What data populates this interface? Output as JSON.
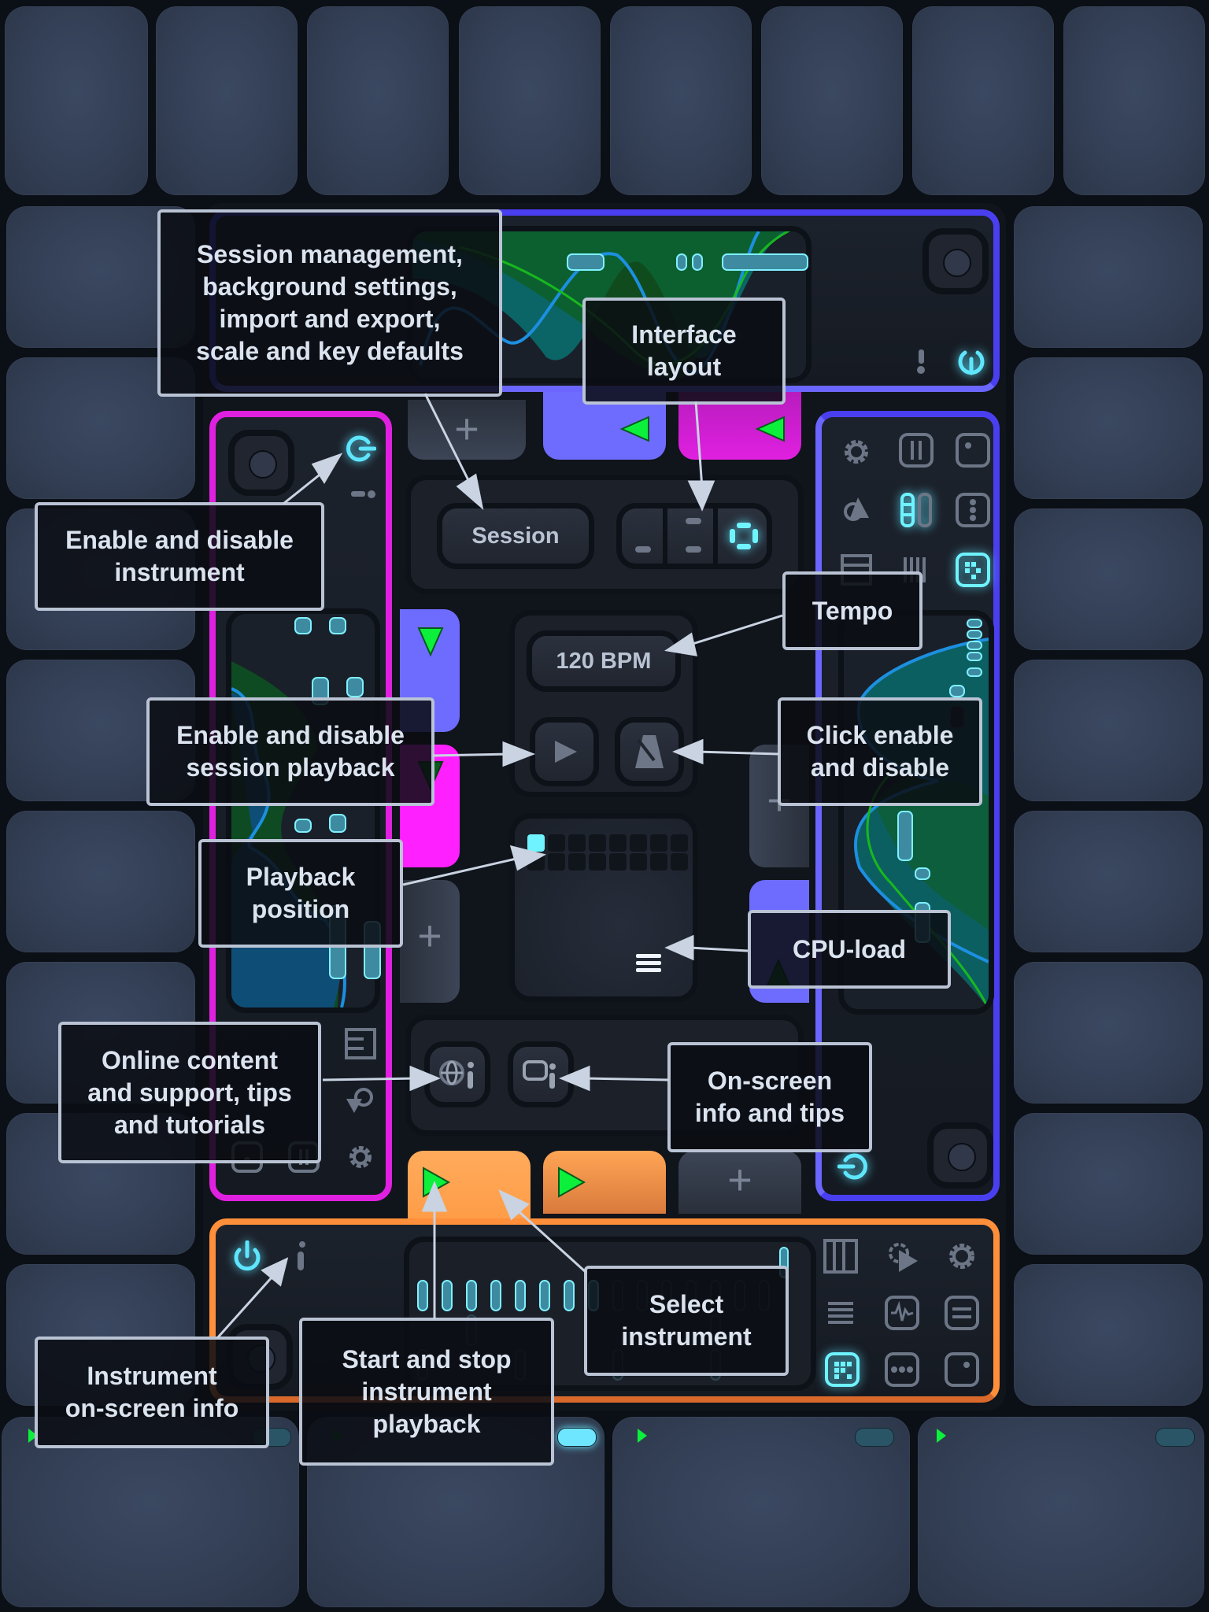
{
  "callouts": {
    "session_management": "Session management,\nbackground settings,\nimport and export,\nscale and key defaults",
    "interface_layout": "Interface\nlayout",
    "enable_instrument": "Enable and disable\ninstrument",
    "tempo": "Tempo",
    "session_playback": "Enable and disable\nsession playback",
    "click": "Click enable\nand disable",
    "playback_position": "Playback\nposition",
    "cpu_load": "CPU-load",
    "online_content": "Online content\nand support, tips\nand tutorials",
    "onscreen_info": "On-screen\ninfo and tips",
    "select_instrument": "Select\ninstrument",
    "instrument_info": "Instrument\non-screen info",
    "start_stop": "Start and stop\ninstrument\nplayback"
  },
  "session": {
    "session_button": "Session",
    "tempo": "120 BPM",
    "playback_position_step": 1,
    "steps_per_row": 8,
    "layout_options": [
      "bottom",
      "split",
      "full"
    ],
    "layout_selected": "full"
  },
  "instrument_tabs": {
    "top": [
      {
        "color": "#6e6cff",
        "state": "play"
      },
      {
        "color": "#e020e0",
        "state": "play"
      },
      {
        "type": "add",
        "label": "+"
      }
    ],
    "left": [
      {
        "color": "#6e6cff",
        "state": "play"
      },
      {
        "color": "#ff20ff",
        "state": "play"
      },
      {
        "type": "add",
        "label": "+"
      }
    ],
    "right": [
      {
        "type": "add",
        "label": "+"
      },
      {
        "color": "#6e6cff",
        "state": "play"
      }
    ],
    "bottom": [
      {
        "color": "#ffa555",
        "state": "play",
        "selected": true
      },
      {
        "color": "#ffa555",
        "state": "play"
      },
      {
        "type": "add",
        "label": "+"
      }
    ]
  },
  "instrument_panel": {
    "accent": "#ff8f3a",
    "icons": [
      "keyboard-icon",
      "gear-play-icon",
      "gear-icon",
      "list-icon",
      "waveform-icon",
      "sliders-icon",
      "grid-pattern-icon",
      "more-icon",
      "dice-icon"
    ],
    "active_icon": "grid-pattern-icon",
    "enabled": true
  },
  "colors": {
    "blue_accent": "#4a3ff0",
    "magenta_accent": "#e020e0",
    "orange_accent": "#ff8f3a",
    "cyan_active": "#6ff3ff",
    "play_green": "#0cf03c"
  },
  "pads": {
    "bottom_row_playing": [
      true,
      false,
      true,
      true
    ],
    "bottom_row_led_active": [
      false,
      true,
      false,
      false
    ]
  }
}
